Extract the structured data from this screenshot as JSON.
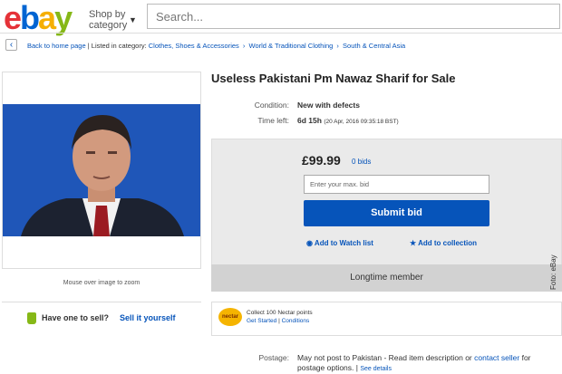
{
  "header": {
    "logo": {
      "e": "e",
      "b": "b",
      "a": "a",
      "y": "y"
    },
    "shop_by": "Shop by",
    "category": "category",
    "search_placeholder": "Search..."
  },
  "breadcrumb": {
    "back": "Back to home page",
    "listed_in": "Listed in category:",
    "items": [
      "Clothes, Shoes & Accessories",
      "World & Traditional Clothing",
      "South & Central Asia"
    ]
  },
  "item": {
    "title": "Useless Pakistani Pm Nawaz Sharif for Sale",
    "zoom_hint": "Mouse over image to zoom",
    "condition_label": "Condition:",
    "condition_value": "New with defects",
    "time_left_label": "Time left:",
    "time_left_value": "6d 15h",
    "time_left_detail": "(20 Apr, 2016   09:35:18 BST)"
  },
  "bid": {
    "price": "£99.99",
    "bids": "0 bids",
    "max_bid_placeholder": "Enter your max. bid",
    "submit_label": "Submit bid",
    "watch_label": "Add to Watch list",
    "collection_label": "Add to collection",
    "longtime": "Longtime member"
  },
  "sell": {
    "question": "Have one to sell?",
    "link": "Sell it yourself"
  },
  "nectar": {
    "logo": "nectar",
    "line1": "Collect 100 Nectar points",
    "get_started": "Get Started",
    "conditions": "Conditions"
  },
  "postage": {
    "label": "Postage:",
    "text1": "May not post to Pakistan - Read item description or ",
    "contact": "contact seller",
    "text2": " for postage options. | ",
    "see_details": "See details"
  },
  "credit": "Foto: eBay",
  "colors": {
    "ebay_red": "#e53238",
    "ebay_blue": "#0064d2",
    "ebay_yellow": "#f5af02",
    "ebay_green": "#86b817",
    "link": "#0654ba"
  }
}
